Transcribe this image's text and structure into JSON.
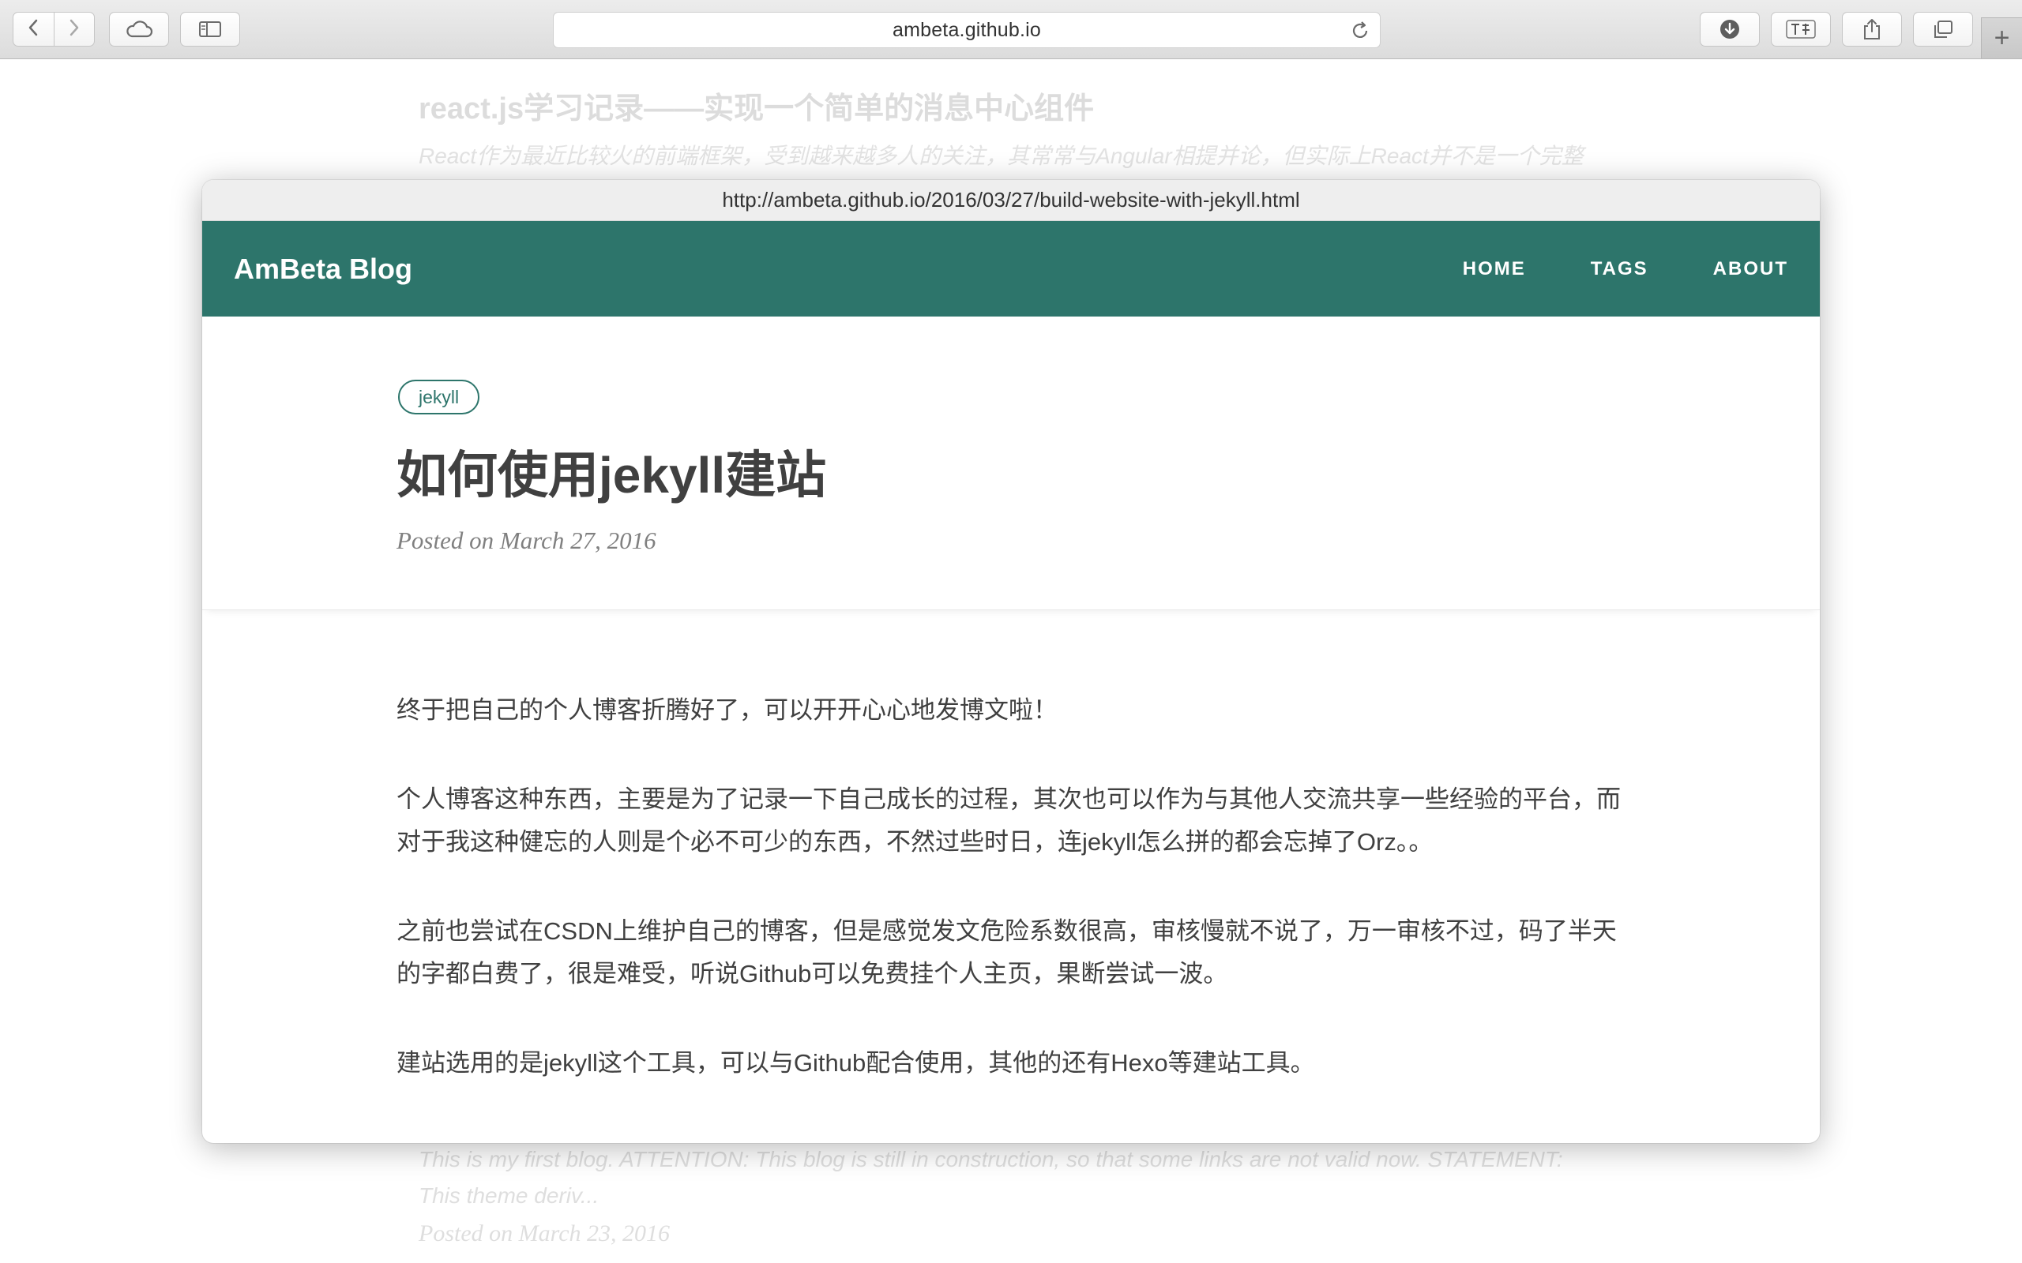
{
  "browser": {
    "address": "ambeta.github.io",
    "icons": {
      "back": "chevron-left-icon",
      "forward": "chevron-right-icon",
      "cloud": "cloud-icon",
      "sidebar": "sidebar-icon",
      "reload": "reload-icon",
      "download": "download-icon",
      "extension": "extension-icon",
      "share": "share-icon",
      "tabs": "tabs-icon",
      "new_tab": "plus-icon"
    },
    "new_tab_label": "+"
  },
  "background_page": {
    "title": "react.js学习记录——实现一个简单的消息中心组件",
    "subtitle": "React作为最近比较火的前端框架，受到越来越多人的关注，其常常与Angular相提并论，但实际上React并不是一个完整",
    "excerpt": "This is my first blog. ATTENTION: This blog is still in construction, so that some links are not valid now. STATEMENT: This theme deriv...",
    "meta": "Posted on March 23, 2016"
  },
  "preview": {
    "url": "http://ambeta.github.io/2016/03/27/build-website-with-jekyll.html",
    "brand": "AmBeta Blog",
    "menu": [
      "HOME",
      "TAGS",
      "ABOUT"
    ],
    "tag": "jekyll",
    "title": "如何使用jekyll建站",
    "meta": "Posted on March 27, 2016",
    "paragraphs": [
      "终于把自己的个人博客折腾好了，可以开开心心地发博文啦！",
      "个人博客这种东西，主要是为了记录一下自己成长的过程，其次也可以作为与其他人交流共享一些经验的平台，而对于我这种健忘的人则是个必不可少的东西，不然过些时日，连jekyll怎么拼的都会忘掉了Orz。。",
      "之前也尝试在CSDN上维护自己的博客，但是感觉发文危险系数很高，审核慢就不说了，万一审核不过，码了半天的字都白费了，很是难受，听说Github可以免费挂个人主页，果断尝试一波。",
      "建站选用的是jekyll这个工具，可以与Github配合使用，其他的还有Hexo等建站工具。"
    ]
  },
  "colors": {
    "brand": "#2d756b",
    "text": "#404040",
    "meta": "#808080"
  }
}
